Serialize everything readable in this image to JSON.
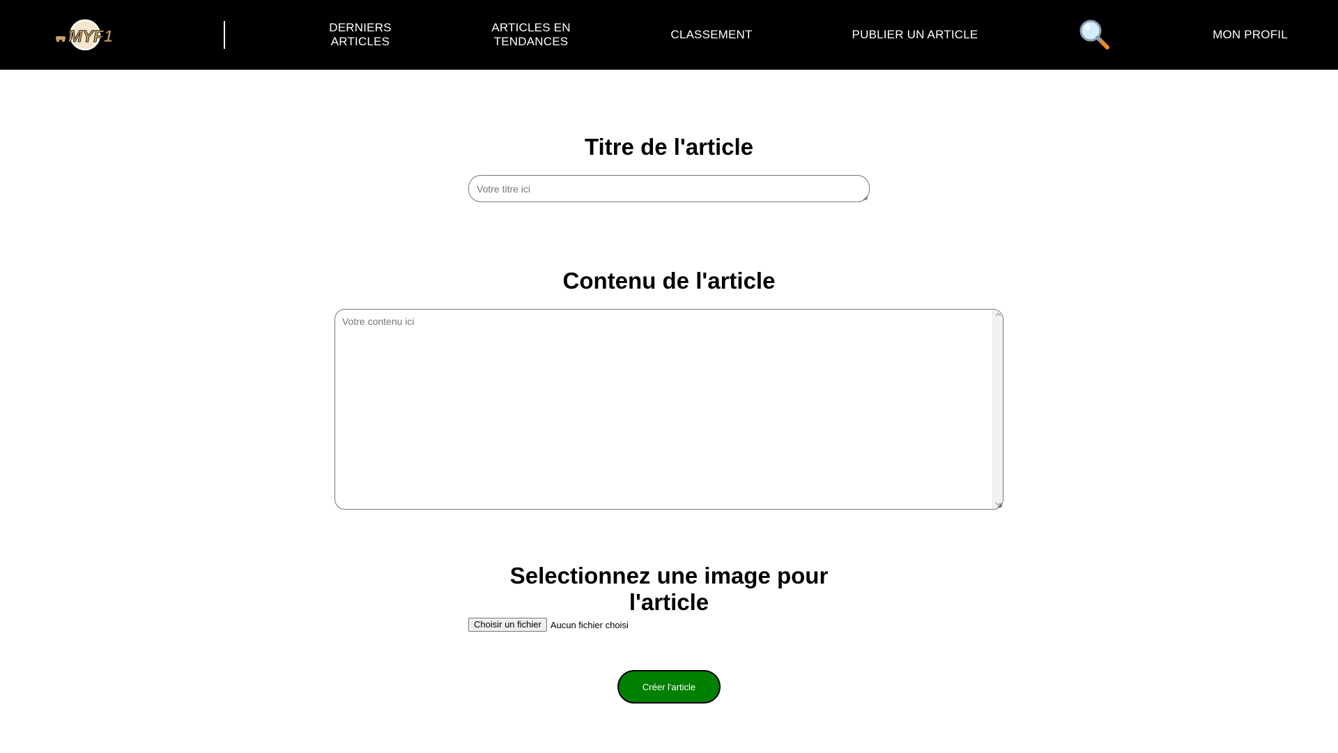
{
  "navbar": {
    "logo_text": "MYF1",
    "links": [
      {
        "label": "DERNIERS\nARTICLES"
      },
      {
        "label": "ARTICLES EN\nTENDANCES"
      },
      {
        "label": "CLASSEMENT"
      },
      {
        "label": "PUBLIER UN ARTICLE"
      }
    ],
    "search_icon": "magnifying-glass-icon",
    "profile_label": "MON PROFIL"
  },
  "form": {
    "title_heading": "Titre de l'article",
    "title_placeholder": "Votre titre ici",
    "title_value": "",
    "content_heading": "Contenu de l'article",
    "content_placeholder": "Votre contenu ici",
    "content_value": "",
    "image_heading": "Selectionnez une image pour\nl'article",
    "file_button_label": "Choisir un fichier",
    "file_status": "Aucun fichier choisi",
    "submit_label": "Créer l'article"
  },
  "colors": {
    "navbar_bg": "#000000",
    "nav_text": "#ffffff",
    "logo_gold": "#c8a064",
    "submit_bg": "#008000",
    "submit_text": "#ffffff"
  }
}
